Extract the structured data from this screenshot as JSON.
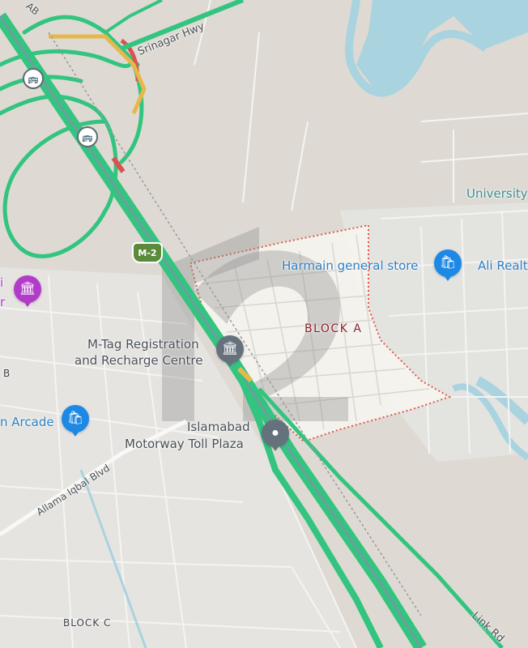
{
  "labels": {
    "srinagar_hwy": "Srinagar Hwy",
    "ab_partial": "AB",
    "university_partial": "University",
    "harmain_store": "Harmain general store",
    "ali_realty_partial": "Ali Realt",
    "block_a": "BLOCK A",
    "b_partial": "B",
    "mtag_line1": "M-Tag Registration",
    "mtag_line2": "and Recharge Centre",
    "arcade_partial": "n Arcade",
    "toll_line1": "Islamabad",
    "toll_line2": "Motorway Toll Plaza",
    "allama_iqbal_blvd": "Allama Iqbal Blvd",
    "block_c": "BLOCK C",
    "link_rd": "Link Rd",
    "motorway_shield": "M-2",
    "left_poi_partial_1": "i",
    "left_poi_partial_2": "r"
  },
  "icons": {
    "bus_stop": "bus-icon",
    "shop": "shopping-bag-icon",
    "government": "bank-icon",
    "toll": "location-icon",
    "landmark": "monument-icon"
  },
  "colors": {
    "land": "#dedad3",
    "water": "#a9d3df",
    "highway_traffic": "#33c480",
    "slow_traffic": "#e6b84a",
    "heavy_traffic": "#d9534f",
    "block_boundary": "#e05a4a",
    "shop_pin": "#1e88e5",
    "poi_pin": "#65727c"
  }
}
